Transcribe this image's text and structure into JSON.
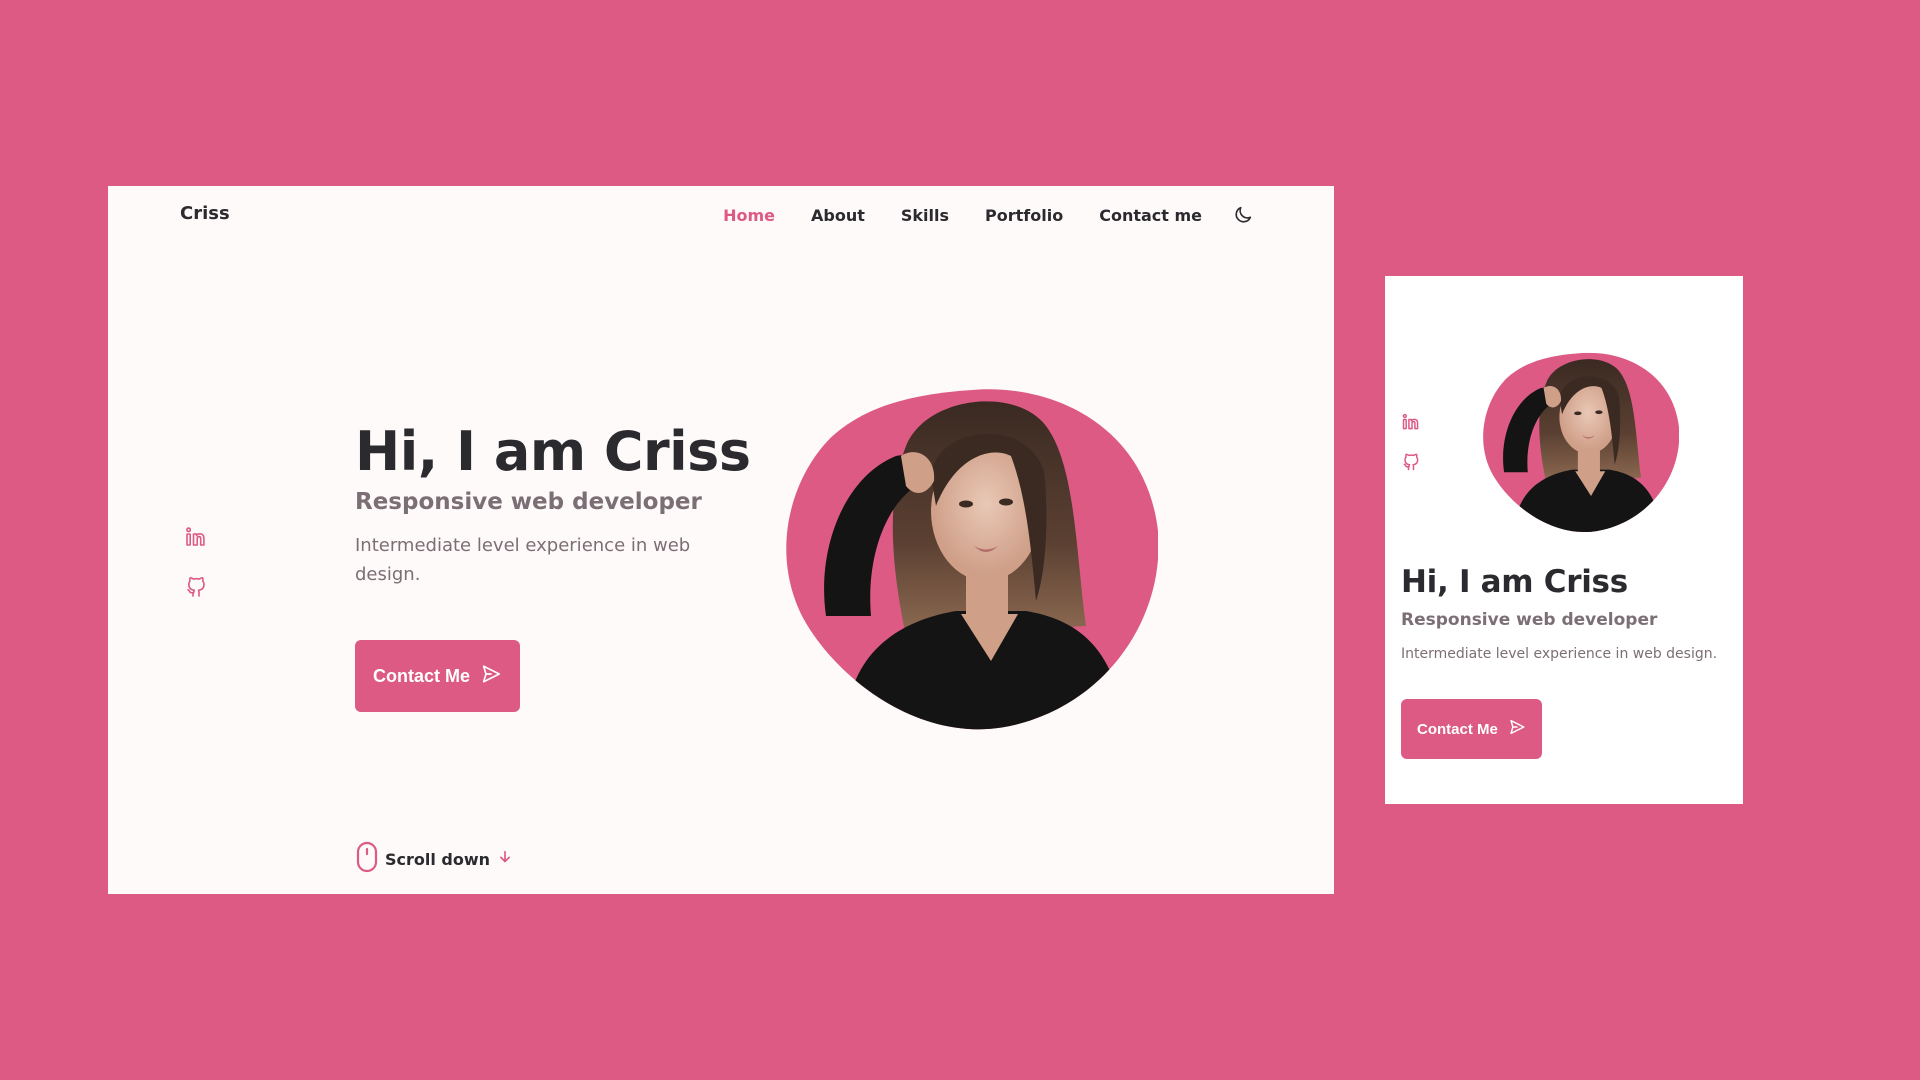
{
  "colors": {
    "background": "#dd5a84",
    "accent": "#dd5a84",
    "page": "#fdfaf9",
    "title": "#2b2a2e",
    "text": "#7b6f75"
  },
  "desktop": {
    "logo": "Criss",
    "nav": [
      {
        "label": "Home",
        "active": true
      },
      {
        "label": "About",
        "active": false
      },
      {
        "label": "Skills",
        "active": false
      },
      {
        "label": "Portfolio",
        "active": false
      },
      {
        "label": "Contact me",
        "active": false
      }
    ],
    "theme_toggle_icon": "moon-icon",
    "social_icons": [
      "linkedin-icon",
      "github-icon"
    ],
    "hero": {
      "title": "Hi, I am Criss",
      "subtitle": "Responsive web developer",
      "description": "Intermediate level experience in web design.",
      "button_label": "Contact Me",
      "button_icon": "send-icon"
    },
    "scroll": {
      "label": "Scroll down",
      "icons": [
        "mouse-icon",
        "arrow-down-icon"
      ]
    }
  },
  "mobile": {
    "social_icons": [
      "linkedin-icon",
      "github-icon"
    ],
    "hero": {
      "title": "Hi, I am Criss",
      "subtitle": "Responsive web developer",
      "description": "Intermediate level experience in web design.",
      "button_label": "Contact Me",
      "button_icon": "send-icon"
    }
  }
}
